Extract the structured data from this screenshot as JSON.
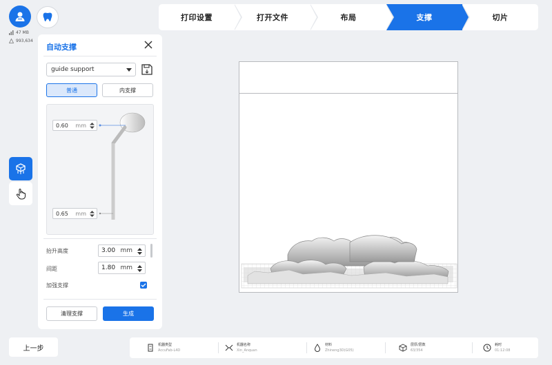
{
  "stats": {
    "memory": "47 MB",
    "count": "993,634"
  },
  "steps": [
    {
      "label": "打印设置",
      "active": false
    },
    {
      "label": "打开文件",
      "active": false
    },
    {
      "label": "布局",
      "active": false
    },
    {
      "label": "支撑",
      "active": true
    },
    {
      "label": "切片",
      "active": false
    }
  ],
  "panel": {
    "title": "自动支撑",
    "preset": "guide support",
    "mode_normal": "普通",
    "mode_inner": "内支撑",
    "top_diameter": "0.60",
    "bottom_diameter": "0.65",
    "unit": "mm",
    "lift_label": "抬升高度",
    "lift_value": "3.00",
    "spacing_label": "间距",
    "spacing_value": "1.80",
    "reinforce_label": "加强支撑",
    "clear_label": "清理支撑",
    "generate_label": "生成"
  },
  "back_label": "上一步",
  "info": [
    {
      "key": "机器类型",
      "value": "AccuFab-L4D",
      "icon": "printer-icon"
    },
    {
      "key": "机器名称",
      "value": "Xin_Anquan",
      "icon": "machine-icon"
    },
    {
      "key": "材料",
      "value": "Zhineng3D(G05)",
      "icon": "resin-drop-icon"
    },
    {
      "key": "层厚/层数",
      "value": "63/354",
      "icon": "layers-cube-icon"
    },
    {
      "key": "耗时",
      "value": "01:12:08",
      "icon": "clock-icon"
    }
  ],
  "colors": {
    "accent": "#1a73e8"
  }
}
